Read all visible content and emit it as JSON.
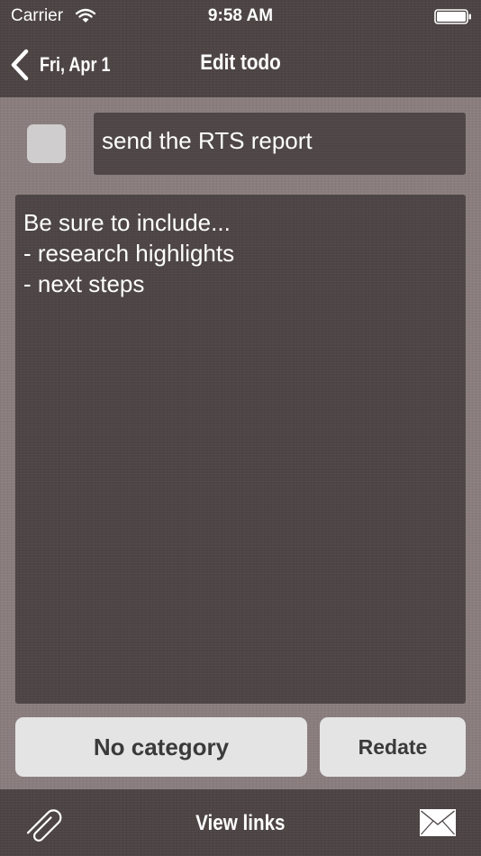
{
  "status_bar": {
    "carrier": "Carrier",
    "time": "9:58 AM",
    "icons": [
      "wifi-icon",
      "battery-icon"
    ]
  },
  "nav": {
    "back_label": "Fri, Apr 1",
    "back_icon": "chevron-left-icon",
    "title": "Edit todo"
  },
  "todo": {
    "completed": false,
    "title": "send the RTS report",
    "notes_lines": [
      "Be sure to include...",
      "- research highlights",
      "- next steps"
    ]
  },
  "actions": {
    "category_label": "No category",
    "redate_label": "Redate"
  },
  "toolbar": {
    "attach_icon": "paperclip-icon",
    "view_links_label": "View links",
    "mail_icon": "envelope-icon"
  },
  "colors": {
    "bar_background": "#4d4444",
    "page_background": "#8a7d7d",
    "field_background": "#4e4646",
    "button_background": "#e5e4e5",
    "button_text": "#3a3a3a",
    "checkbox": "#cfcdcd",
    "text_light": "#ffffff"
  }
}
